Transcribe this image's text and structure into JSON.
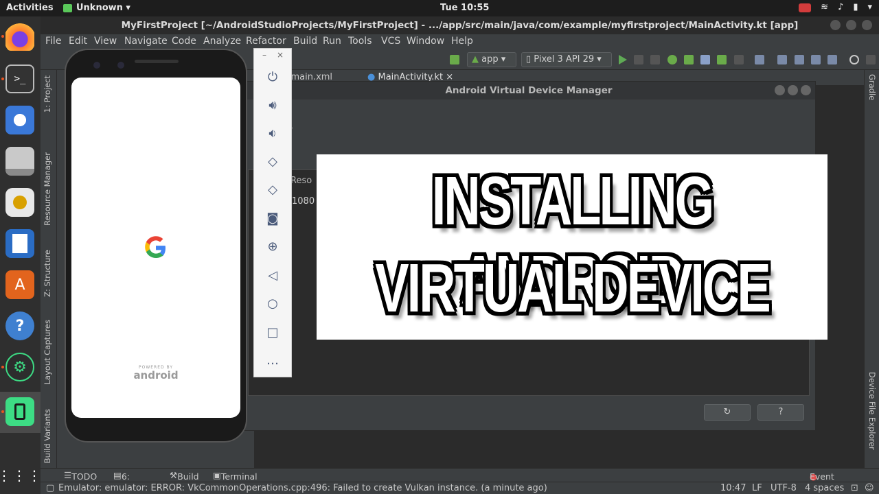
{
  "topbar": {
    "activities": "Activities",
    "app_menu": "Unknown ▾",
    "clock": "Tue 10:55"
  },
  "ide": {
    "window_title": "MyFirstProject [~/AndroidStudioProjects/MyFirstProject] - .../app/src/main/java/com/example/myfirstproject/MainActivity.kt [app]",
    "menu": [
      "File",
      "Edit",
      "View",
      "Navigate",
      "Code",
      "Analyze",
      "Refactor",
      "Build",
      "Run",
      "Tools",
      "VCS",
      "Window",
      "Help"
    ],
    "run_config": "app",
    "device": "Pixel 3 API 29",
    "tabs": [
      "ctivity_main.xml",
      "MainActivity.kt"
    ],
    "left_tool_windows": [
      "1: Project",
      "Resource Manager",
      "Z: Structure",
      "Layout Captures",
      "Build Variants"
    ],
    "right_tool_windows": [
      "Gradle",
      "Device File Explorer"
    ],
    "bottom_tools": [
      "TODO",
      "6: Logcat",
      "Build",
      "Terminal"
    ],
    "event_log": "Event Log",
    "status_message": "Emulator: emulator: ERROR: VkCommonOperations.cpp:496: Failed to create Vulkan instance. (a minute ago)",
    "status_right": {
      "position": "10:47",
      "line_sep": "LF",
      "encoding": "UTF-8",
      "indent": "4 spaces"
    }
  },
  "avd_manager": {
    "title": "Android Virtual Device Manager",
    "heading_partial": "s",
    "column_partial": "Reso",
    "cell_partial": "1080",
    "refresh_icon": "↻",
    "help_label": "?"
  },
  "emulator": {
    "powered_by": "POWERED BY",
    "android": "android",
    "controls": [
      "power-icon",
      "volume-up-icon",
      "volume-down-icon",
      "rotate-left-icon",
      "rotate-right-icon",
      "camera-icon",
      "zoom-icon",
      "back-icon",
      "home-icon",
      "overview-icon",
      "more-icon"
    ]
  },
  "overlay": {
    "line1": "INSTALLING ANDROID",
    "line2": "VIRTUAL DEVICE"
  },
  "colors": {
    "ubuntu_orange": "#e95420",
    "ide_bg": "#3c3f41",
    "editor_bg": "#2b2b2b"
  }
}
